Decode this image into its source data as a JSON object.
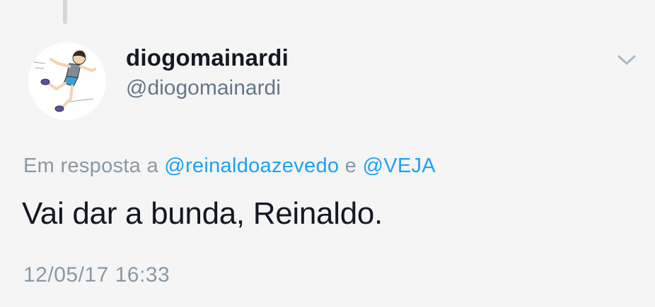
{
  "tweet": {
    "author": {
      "display_name": "diogomainardi",
      "handle": "@diogomainardi",
      "avatar_icon": "cartoon-runner-avatar"
    },
    "reply": {
      "prefix": "Em resposta a ",
      "mention_1": "@reinaldoazevedo",
      "joiner": " e ",
      "mention_2": "@VEJA"
    },
    "text": "Vai dar a bunda, Reinaldo.",
    "timestamp": "12/05/17 16:33",
    "menu_icon": "chevron-down-icon"
  },
  "colors": {
    "background": "#f5f5f6",
    "text": "#141823",
    "secondary": "#8899a6",
    "mention": "#1da1f2"
  }
}
